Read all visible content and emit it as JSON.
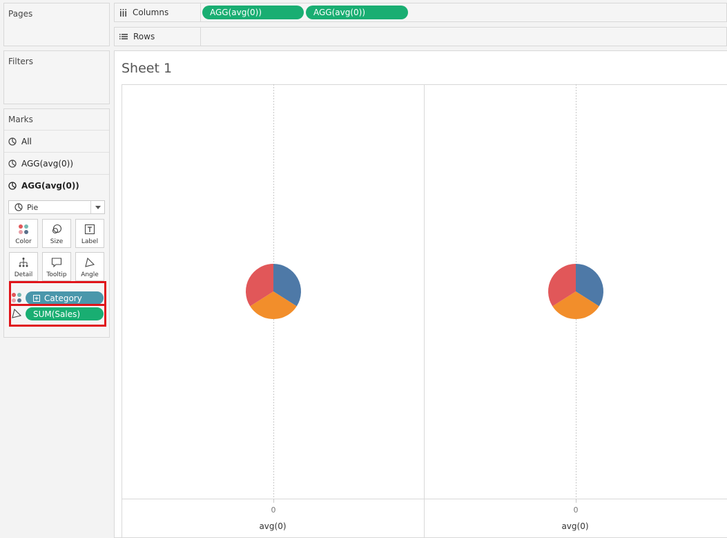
{
  "panes": {
    "pages": "Pages",
    "filters": "Filters",
    "marks": {
      "title": "Marks",
      "rows": [
        "All",
        "AGG(avg(0))",
        "AGG(avg(0))"
      ],
      "mark_type": "Pie",
      "buttons": [
        "Color",
        "Size",
        "Label",
        "Detail",
        "Tooltip",
        "Angle"
      ],
      "fields": {
        "color": "Category",
        "angle": "SUM(Sales)"
      }
    }
  },
  "shelves": {
    "columns": {
      "label": "Columns",
      "pills": [
        "AGG(avg(0))",
        "AGG(avg(0))"
      ]
    },
    "rows": {
      "label": "Rows"
    }
  },
  "sheet": {
    "title": "Sheet 1",
    "panes": [
      {
        "tick": "0",
        "axis_title": "avg(0)"
      },
      {
        "tick": "0",
        "axis_title": "avg(0)"
      }
    ]
  },
  "chart_data": {
    "type": "pie",
    "charts": [
      {
        "slices": [
          {
            "color": "#4e79a7",
            "fraction": 0.34
          },
          {
            "color": "#f28e2b",
            "fraction": 0.32
          },
          {
            "color": "#e15759",
            "fraction": 0.34
          }
        ]
      },
      {
        "slices": [
          {
            "color": "#4e79a7",
            "fraction": 0.34
          },
          {
            "color": "#f28e2b",
            "fraction": 0.32
          },
          {
            "color": "#e15759",
            "fraction": 0.34
          }
        ]
      }
    ]
  },
  "colors": {
    "pill_green": "#19ae72",
    "pill_blue": "#4a97ab",
    "highlight": "#e0141a"
  }
}
